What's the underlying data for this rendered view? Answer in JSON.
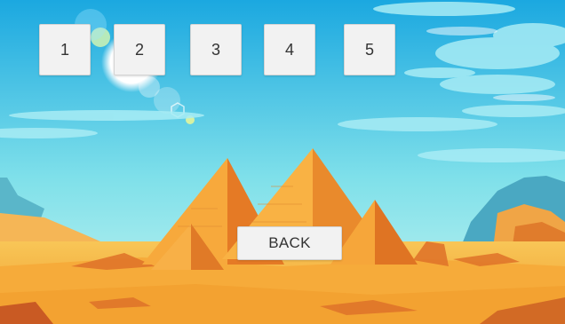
{
  "level_buttons": [
    {
      "label": "1"
    },
    {
      "label": "2"
    },
    {
      "label": "3"
    },
    {
      "label": "4"
    },
    {
      "label": "5"
    }
  ],
  "back_button": {
    "label": "BACK"
  },
  "colors": {
    "sky_top": "#2fb7e6",
    "sky_bottom": "#a6eef0",
    "sand": "#f3b53f",
    "pyramid_light": "#f7a93c",
    "pyramid_dark": "#e57a25",
    "button_bg": "#f2f2f2"
  }
}
